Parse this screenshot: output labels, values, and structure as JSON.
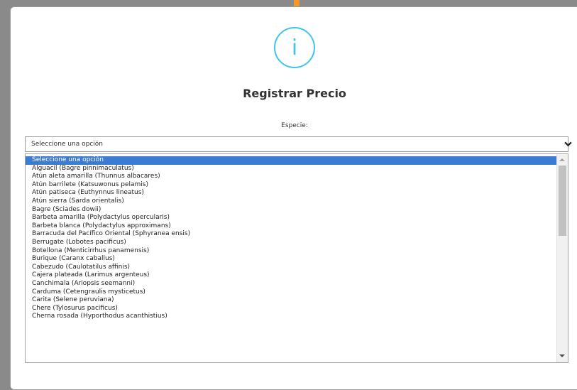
{
  "modal": {
    "title": "Registrar Precio",
    "info_glyph": "i",
    "field_label": "Especie:"
  },
  "select": {
    "value": "Seleccione una opción"
  },
  "options": [
    "Seleccione una opción",
    "Alguacil (Bagre pinnimaculatus)",
    "Atún aleta amarilla (Thunnus albacares)",
    "Atún barrilete (Katsuwonus pelamis)",
    "Atún patiseca (Euthynnus lineatus)",
    "Atún sierra (Sarda orientalis)",
    "Bagre (Sciades dowii)",
    "Barbeta amarilla (Polydactylus opercularis)",
    "Barbeta blanca (Polydactylus approximans)",
    "Barracuda del Pacífico Oriental (Sphyranea ensis)",
    "Berrugate (Lobotes pacificus)",
    "Botellona (Menticirrhus panamensis)",
    "Burique (Caranx caballus)",
    "Cabezudo (Caulotatilus affinis)",
    "Cajera plateada (Larimus argenteus)",
    "Canchimala (Ariopsis seemanni)",
    "Carduma (Cetengraulis mysticetus)",
    "Carita (Selene peruviana)",
    "Chere (Tylosurus pacificus)",
    "Cherna rosada (Hyporthodus acanthistius)"
  ],
  "selected_index": 0,
  "colors": {
    "accent_orange": "#f39a2e",
    "info_cyan": "#3ec6e8",
    "selection_blue": "#3b7bd4"
  },
  "icons": {
    "info": "info-icon",
    "select_arrow": "chevron-down-icon"
  }
}
